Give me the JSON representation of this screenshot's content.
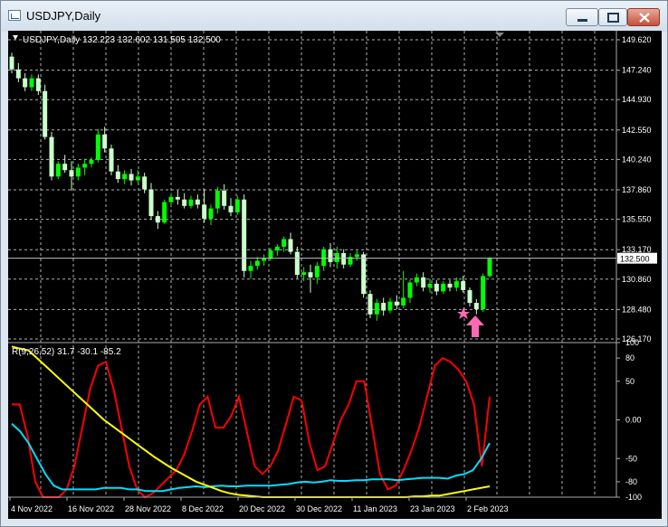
{
  "window": {
    "title": "USDJPY,Daily"
  },
  "main_panel": {
    "header": "USDJPY,Daily  132.223 132.602 131.505 132.500",
    "price_labels": [
      "149.620",
      "147.240",
      "144.930",
      "142.550",
      "140.240",
      "137.860",
      "135.550",
      "133.170",
      "130.860",
      "128.480",
      "126.170"
    ],
    "price_values": [
      149.62,
      147.24,
      144.93,
      142.55,
      140.24,
      137.86,
      135.55,
      133.17,
      130.86,
      128.48,
      126.17
    ],
    "current_price_label": "132.500",
    "current_price": 132.5
  },
  "indicator_panel": {
    "header": "R(9,26,52) 31.7 -30.1 -85.2",
    "level_labels": [
      "100",
      "80",
      "50",
      "0.00",
      "-50",
      "-80",
      "-100"
    ],
    "level_values": [
      100,
      80,
      50,
      0,
      -50,
      -80,
      -100
    ]
  },
  "date_labels": [
    "4 Nov 2022",
    "16 Nov 2022",
    "28 Nov 2022",
    "8 Dec 2022",
    "20 Dec 2022",
    "30 Dec 2022",
    "11 Jan 2023",
    "23 Jan 2023",
    "2 Feb 2023"
  ],
  "colors": {
    "background": "#000000",
    "bull": "#00ff00",
    "bear": "#ccffcc",
    "grid": "#b0b0b0",
    "fast": "#ff0000",
    "medium": "#00e0ff",
    "slow": "#ffff00",
    "marker": "#ff69b4"
  },
  "chart_data": [
    {
      "type": "candlestick",
      "title": "USDJPY,Daily",
      "ylim": [
        126.17,
        149.62
      ],
      "ohlc": [
        [
          148.3,
          148.6,
          147.0,
          147.3
        ],
        [
          147.3,
          147.8,
          146.3,
          146.6
        ],
        [
          146.6,
          147.0,
          145.6,
          145.9
        ],
        [
          145.9,
          146.9,
          145.6,
          146.6
        ],
        [
          146.6,
          146.9,
          145.3,
          145.6
        ],
        [
          145.6,
          146.1,
          141.8,
          142.0
        ],
        [
          142.0,
          142.4,
          138.6,
          138.9
        ],
        [
          138.9,
          140.1,
          138.7,
          139.9
        ],
        [
          139.9,
          140.6,
          139.2,
          139.4
        ],
        [
          139.4,
          140.1,
          137.8,
          138.9
        ],
        [
          138.9,
          139.9,
          138.6,
          139.6
        ],
        [
          139.6,
          140.3,
          139.0,
          139.9
        ],
        [
          139.9,
          140.4,
          139.6,
          140.2
        ],
        [
          140.2,
          142.6,
          140.0,
          142.2
        ],
        [
          142.2,
          142.8,
          140.8,
          141.1
        ],
        [
          141.1,
          141.4,
          139.0,
          139.3
        ],
        [
          139.3,
          139.8,
          138.4,
          138.7
        ],
        [
          138.7,
          139.4,
          138.3,
          139.1
        ],
        [
          139.1,
          139.5,
          138.2,
          138.6
        ],
        [
          138.6,
          139.4,
          138.4,
          138.9
        ],
        [
          138.9,
          139.2,
          137.6,
          137.9
        ],
        [
          137.9,
          138.4,
          135.5,
          135.8
        ],
        [
          135.8,
          136.2,
          134.8,
          135.3
        ],
        [
          135.3,
          137.1,
          135.2,
          136.9
        ],
        [
          136.9,
          137.6,
          136.6,
          137.3
        ],
        [
          137.3,
          137.8,
          136.7,
          137.1
        ],
        [
          137.1,
          137.6,
          136.4,
          136.6
        ],
        [
          136.6,
          137.4,
          136.4,
          137.1
        ],
        [
          137.1,
          137.5,
          136.4,
          136.7
        ],
        [
          136.7,
          137.9,
          135.3,
          135.6
        ],
        [
          135.6,
          136.7,
          135.1,
          136.4
        ],
        [
          136.4,
          138.1,
          136.0,
          137.8
        ],
        [
          137.8,
          138.3,
          136.3,
          136.6
        ],
        [
          136.6,
          137.2,
          135.8,
          136.1
        ],
        [
          136.1,
          137.4,
          135.9,
          137.1
        ],
        [
          137.1,
          137.5,
          131.0,
          131.5
        ],
        [
          131.5,
          132.3,
          130.9,
          131.9
        ],
        [
          131.9,
          132.6,
          131.6,
          132.3
        ],
        [
          132.3,
          132.8,
          131.9,
          132.5
        ],
        [
          132.5,
          133.3,
          132.3,
          133.1
        ],
        [
          133.1,
          133.6,
          132.7,
          133.4
        ],
        [
          133.4,
          134.2,
          133.0,
          134.0
        ],
        [
          134.0,
          134.5,
          132.8,
          133.0
        ],
        [
          133.0,
          133.4,
          130.9,
          131.2
        ],
        [
          131.2,
          131.8,
          130.7,
          131.4
        ],
        [
          131.4,
          132.0,
          129.8,
          131.0
        ],
        [
          131.0,
          132.2,
          130.5,
          131.9
        ],
        [
          131.9,
          133.4,
          131.5,
          133.2
        ],
        [
          133.2,
          133.7,
          131.8,
          132.2
        ],
        [
          132.2,
          133.4,
          131.7,
          132.9
        ],
        [
          132.9,
          133.2,
          131.7,
          132.0
        ],
        [
          132.0,
          132.9,
          131.8,
          132.6
        ],
        [
          132.6,
          133.1,
          132.3,
          132.8
        ],
        [
          132.8,
          133.0,
          129.4,
          129.7
        ],
        [
          129.7,
          130.0,
          127.8,
          128.1
        ],
        [
          128.1,
          129.3,
          127.6,
          129.0
        ],
        [
          129.0,
          129.4,
          128.0,
          128.4
        ],
        [
          128.4,
          129.4,
          128.2,
          129.1
        ],
        [
          129.1,
          129.6,
          128.5,
          128.8
        ],
        [
          128.8,
          131.5,
          128.6,
          129.4
        ],
        [
          129.4,
          130.8,
          129.0,
          130.6
        ],
        [
          130.6,
          131.3,
          130.3,
          131.0
        ],
        [
          131.0,
          131.4,
          129.9,
          130.2
        ],
        [
          130.2,
          130.9,
          129.8,
          130.5
        ],
        [
          130.5,
          130.8,
          129.6,
          129.9
        ],
        [
          129.9,
          130.7,
          129.7,
          130.5
        ],
        [
          130.5,
          130.8,
          129.9,
          130.2
        ],
        [
          130.2,
          131.0,
          129.9,
          130.7
        ],
        [
          130.7,
          131.1,
          129.8,
          130.0
        ],
        [
          130.0,
          130.2,
          128.7,
          129.0
        ],
        [
          129.0,
          129.3,
          128.1,
          128.5
        ],
        [
          128.5,
          131.3,
          128.3,
          131.1
        ],
        [
          131.1,
          132.6,
          131.0,
          132.5
        ]
      ]
    },
    {
      "type": "line",
      "title": "R(9,26,52) 31.7 -30.1 -85.2",
      "ylim": [
        -100,
        100
      ],
      "series": [
        {
          "values": [
            20,
            20,
            -20,
            -80,
            -100,
            -100,
            -100,
            -90,
            -60,
            -10,
            40,
            70,
            75,
            40,
            -10,
            -60,
            -90,
            -100,
            -95,
            -85,
            -75,
            -65,
            -45,
            -15,
            20,
            30,
            -10,
            -10,
            5,
            30,
            -15,
            -60,
            -70,
            -60,
            -40,
            -5,
            30,
            25,
            -30,
            -65,
            -60,
            -30,
            0,
            20,
            50,
            50,
            -10,
            -70,
            -90,
            -85,
            -65,
            -40,
            -10,
            30,
            70,
            80,
            75,
            65,
            50,
            20,
            -60,
            30
          ]
        },
        {
          "values": [
            -5,
            -15,
            -30,
            -50,
            -70,
            -85,
            -90,
            -90,
            -90,
            -90,
            -90,
            -88,
            -88,
            -88,
            -90,
            -90,
            -92,
            -92,
            -92,
            -90,
            -88,
            -87,
            -86,
            -87,
            -86,
            -85,
            -86,
            -86,
            -85,
            -85,
            -85,
            -85,
            -84,
            -83,
            -81,
            -80,
            -81,
            -80,
            -78,
            -79,
            -79,
            -78,
            -78,
            -77,
            -77,
            -77,
            -78,
            -77,
            -76,
            -75,
            -75,
            -75,
            -76,
            -72,
            -70,
            -65,
            -50,
            -30
          ]
        },
        {
          "values": [
            95,
            92,
            90,
            80,
            70,
            60,
            50,
            40,
            30,
            20,
            10,
            0,
            -8,
            -16,
            -24,
            -32,
            -40,
            -48,
            -55,
            -62,
            -68,
            -74,
            -80,
            -84,
            -88,
            -92,
            -95,
            -97,
            -98,
            -99,
            -100,
            -100,
            -100,
            -100,
            -100,
            -100,
            -100,
            -100,
            -100,
            -100,
            -100,
            -100,
            -100,
            -100,
            -100,
            -100,
            -100,
            -100,
            -99,
            -99,
            -98,
            -98,
            -96,
            -94,
            -92,
            -90,
            -88,
            -86
          ]
        }
      ]
    }
  ]
}
